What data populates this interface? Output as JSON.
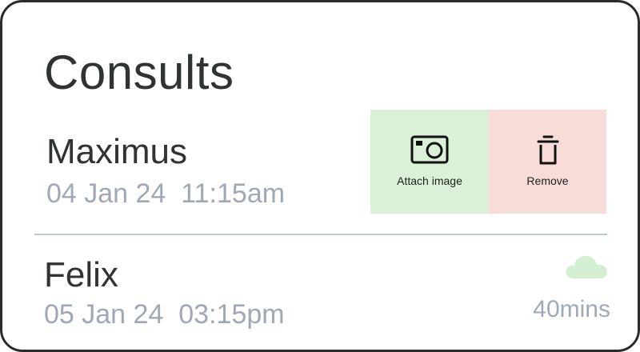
{
  "header": {
    "title": "Consults"
  },
  "consults": [
    {
      "name": "Maximus",
      "date": "04 Jan 24",
      "time": "11:15am",
      "actions": {
        "attach_label": "Attach image",
        "attach_icon": "camera-icon",
        "remove_label": "Remove",
        "remove_icon": "trash-icon"
      }
    },
    {
      "name": "Felix",
      "date": "05 Jan 24",
      "time": "03:15pm",
      "duration": "40mins",
      "status_icon": "cloud-icon"
    }
  ],
  "colors": {
    "attach_bg": "#daf1d8",
    "remove_bg": "#f7dcd7",
    "cloud": "#d4eed2",
    "muted_text": "#a0a8b6",
    "divider": "#b8ccc4"
  }
}
